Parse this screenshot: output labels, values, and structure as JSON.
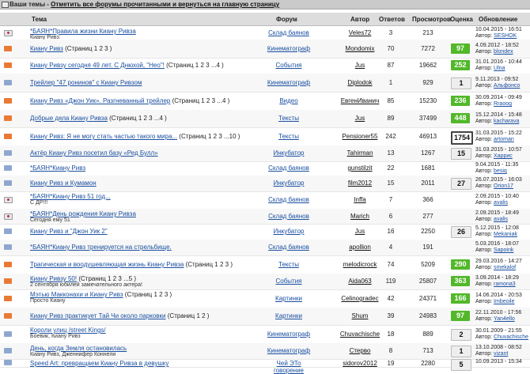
{
  "topbar": {
    "label": "Ваши темы",
    "link": "Отметить все форумы прочитанными и вернуться на главную страницу"
  },
  "header": {
    "topic": "Тема",
    "forum": "Форум",
    "author": "Автор",
    "answers": "Ответов",
    "views": "Просмотров",
    "rating": "Оценка",
    "updated": "Обновление"
  },
  "rows": [
    {
      "icon": "read",
      "title": "*БАЯН*Правила жизни Киану Ривза",
      "pages": "",
      "sub": "Киану Ривз:",
      "forum": "Склад баянов",
      "author": "Veles72",
      "answers": "3",
      "views": "213",
      "rating": "",
      "rating_style": "",
      "date": "10.04.2015 - 16:51",
      "last": "SESHOK"
    },
    {
      "icon": "envelope",
      "title": "Киану Ривз",
      "pages": "(Страниц 1 2 3 )",
      "sub": "",
      "forum": "Кинематограф",
      "author": "Mondomix",
      "answers": "70",
      "views": "7272",
      "rating": "97",
      "rating_style": "g",
      "date": "4.09.2012 - 18:52",
      "last": "blondex"
    },
    {
      "icon": "envelope",
      "title": "Киану Ривзу сегодня 49 лет. С Днюхой, \"Нео\"!",
      "pages": "(Страниц 1 2 3 ...4 )",
      "sub": "",
      "forum": "События",
      "author": "Jus",
      "answers": "87",
      "views": "19662",
      "rating": "252",
      "rating_style": "g",
      "date": "31.01.2016 - 10:44",
      "last": "Ulna"
    },
    {
      "icon": "blue",
      "title": "Трейлер \"47 ронинов\" с Киану Ривзом",
      "pages": "",
      "sub": "",
      "forum": "Кинематограф",
      "author": "Diplodok",
      "answers": "1",
      "views": "929",
      "rating": "1",
      "rating_style": "w",
      "date": "9.11.2013 - 09:52",
      "last": "Альфонсо"
    },
    {
      "icon": "envelope",
      "title": "Киану Ривз «Джон Уик». Разгневанный трейлер",
      "pages": "(Страниц 1 2 3 ...4 )",
      "sub": "",
      "forum": "Видео",
      "author": "ЕвгенИванич",
      "answers": "85",
      "views": "15230",
      "rating": "236",
      "rating_style": "g",
      "date": "30.09.2014 - 09:49",
      "last": "Rraoog"
    },
    {
      "icon": "envelope",
      "title": "Добрые дела Киану Ривза",
      "pages": "(Страниц 1 2 3 ...4 )",
      "sub": "",
      "forum": "Тексты",
      "author": "Jus",
      "answers": "89",
      "views": "37499",
      "rating": "448",
      "rating_style": "g",
      "date": "15.12.2014 - 15:48",
      "last": "kacharava"
    },
    {
      "icon": "envelope",
      "title": "Киану Ривз: Я не могу стать частью такого мира...",
      "pages": "(Страниц 1 2 3 ...10 )",
      "sub": "",
      "forum": "Тексты",
      "author": "Pensioner55",
      "answers": "242",
      "views": "46913",
      "rating": "1754",
      "rating_style": "bw",
      "date": "31.03.2015 - 15:22",
      "last": "artoman"
    },
    {
      "icon": "blue",
      "title": "Актёр Киану Ривз посетил базу «Ред Булл»",
      "pages": "",
      "sub": "",
      "forum": "Инкубатор",
      "author": "Tahirman",
      "answers": "13",
      "views": "1267",
      "rating": "15",
      "rating_style": "w",
      "date": "31.03.2015 - 10:57",
      "last": "Харрис"
    },
    {
      "icon": "blue",
      "title": "*БАЯН*Киану Ривз",
      "pages": "",
      "sub": "",
      "forum": "Склад баянов",
      "author": "gunstilzit",
      "answers": "22",
      "views": "1681",
      "rating": "",
      "rating_style": "",
      "date": "9.04.2015 - 11:35",
      "last": "besiq"
    },
    {
      "icon": "blue",
      "title": "Киану Ривз и Кумамон",
      "pages": "",
      "sub": "",
      "forum": "Инкубатор",
      "author": "film2012",
      "answers": "15",
      "views": "2011",
      "rating": "27",
      "rating_style": "w",
      "date": "26.07.2015 - 16:03",
      "last": "Orion17"
    },
    {
      "icon": "read",
      "title": "*БАЯН*Киану Ривз 51 год...",
      "pages": "",
      "sub": "С ДР!!!",
      "forum": "Склад баянов",
      "author": "Inffa",
      "answers": "7",
      "views": "366",
      "rating": "",
      "rating_style": "",
      "date": "2.09.2015 - 10:40",
      "last": "avalis"
    },
    {
      "icon": "read",
      "title": "*БАЯН*День рождения Киану Ривза",
      "pages": "",
      "sub": "Сегодня ему 51",
      "forum": "Склад баянов",
      "author": "Marich",
      "answers": "6",
      "views": "277",
      "rating": "",
      "rating_style": "",
      "date": "2.09.2015 - 18:49",
      "last": "avalis"
    },
    {
      "icon": "blue",
      "title": "Киану Ривз и \"Джон Уик 2\"",
      "pages": "",
      "sub": "",
      "forum": "Инкубатор",
      "author": "Jus",
      "answers": "16",
      "views": "2250",
      "rating": "26",
      "rating_style": "w",
      "date": "5.12.2015 - 12:08",
      "last": "Mekaniak"
    },
    {
      "icon": "blue",
      "title": "*БАЯН*Киану Ривз тренируется на стрельбище.",
      "pages": "",
      "sub": "",
      "forum": "Склад баянов",
      "author": "apollion",
      "answers": "4",
      "views": "191",
      "rating": "",
      "rating_style": "",
      "date": "5.03.2016 - 18:07",
      "last": "Sapoink"
    },
    {
      "icon": "envelope",
      "title": "Трагическая и воодушевляющая жизнь Киану Ривза",
      "pages": "(Страниц 1 2 3 )",
      "sub": "",
      "forum": "Тексты",
      "author": "melodicrock",
      "answers": "74",
      "views": "5209",
      "rating": "290",
      "rating_style": "g",
      "date": "29.03.2016 - 14:27",
      "last": "smekalof"
    },
    {
      "icon": "envelope",
      "title": "Киану Ривзу 50!",
      "pages": "(Страниц 1 2 3 ...5 )",
      "sub": "2 сентября юбилей замечательного актера!",
      "forum": "События",
      "author": "Aida063",
      "answers": "119",
      "views": "25807",
      "rating": "363",
      "rating_style": "g",
      "date": "3.09.2014 - 18:29",
      "last": "ramona3"
    },
    {
      "icon": "envelope",
      "title": "Мэтью Макконахи и Киану Ривз",
      "pages": "(Страниц 1 2 3 )",
      "sub": "Просто Киану",
      "forum": "Картинки",
      "author": "Celinogradec",
      "answers": "42",
      "views": "24371",
      "rating": "166",
      "rating_style": "g",
      "date": "14.06.2014 - 20:53",
      "last": "Imbeoile"
    },
    {
      "icon": "envelope",
      "title": "Киану Ривз практикует Тай Чи около парковки",
      "pages": "(Страниц 1 2 )",
      "sub": "",
      "forum": "Картинки",
      "author": "Shum",
      "answers": "39",
      "views": "24983",
      "rating": "97",
      "rating_style": "g",
      "date": "22.11.2010 - 17:56",
      "last": "Yan4ello"
    },
    {
      "icon": "blue",
      "title": "Короли улиц /street Kings/",
      "pages": "",
      "sub": "Боевик, Киану Ривз",
      "forum": "Кинематограф",
      "author": "Chuvachische",
      "answers": "18",
      "views": "889",
      "rating": "2",
      "rating_style": "w",
      "date": "30.01.2009 - 21:55",
      "last": "Chuvachische"
    },
    {
      "icon": "blue",
      "title": "День, когда Земля остановилась",
      "pages": "",
      "sub": "Киану Ривз, Дженнифер Коннели",
      "forum": "Кинематограф",
      "author": "Стерво",
      "answers": "8",
      "views": "713",
      "rating": "1",
      "rating_style": "w",
      "date": "13.10.2008 - 08:52",
      "last": "vizant"
    },
    {
      "icon": "blue",
      "title": "Speed Art: превращаем Киану Ривза в девушку",
      "pages": "",
      "sub": "",
      "forum": "Чей ЭТо говорение",
      "author": "sidorov2012",
      "answers": "19",
      "views": "2280",
      "rating": "5",
      "rating_style": "w",
      "date": "10.09.2013 - 15:34",
      "last": ""
    }
  ],
  "author_prefix": "Автор: "
}
